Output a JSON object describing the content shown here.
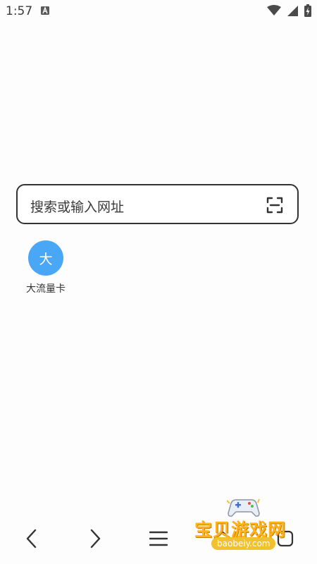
{
  "status_bar": {
    "time": "1:57",
    "app_icon": "a-icon",
    "icons": [
      "wifi-icon",
      "signal-icon",
      "battery-charging-icon"
    ]
  },
  "search": {
    "placeholder": "搜索或输入网址",
    "scan_icon": "scan-icon"
  },
  "shortcuts": [
    {
      "initial": "大",
      "label": "大流量卡",
      "color": "#4aa7f5"
    }
  ],
  "bottom_nav": {
    "items": [
      "back-icon",
      "forward-icon",
      "menu-icon",
      "home-icon",
      "tabs-icon"
    ]
  },
  "watermark": {
    "text": "宝贝游戏网",
    "url": "baobeiy.com"
  }
}
